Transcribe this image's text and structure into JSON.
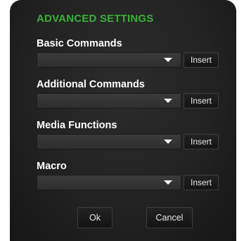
{
  "dialog": {
    "title": "ADVANCED SETTINGS",
    "accent_color": "#36b233",
    "background_color": "#242424"
  },
  "sections": [
    {
      "label": "Basic Commands",
      "value": "",
      "button_label": "Insert"
    },
    {
      "label": "Additional Commands",
      "value": "",
      "button_label": "Insert"
    },
    {
      "label": "Media Functions",
      "value": "",
      "button_label": "Insert"
    },
    {
      "label": "Macro",
      "value": "",
      "button_label": "Insert"
    }
  ],
  "footer": {
    "ok_label": "Ok",
    "cancel_label": "Cancel"
  },
  "icons": {
    "dropdown": "chevron-down-icon"
  }
}
